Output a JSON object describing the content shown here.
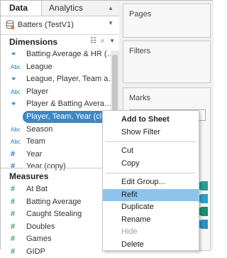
{
  "tabs": {
    "data": "Data",
    "analytics": "Analytics"
  },
  "datasource": {
    "name": "Batters (TestV1)",
    "icon": "datasource-icon"
  },
  "dimensions": {
    "title": "Dimensions",
    "items": [
      {
        "type": "link",
        "label": "Batting Average & HR (…"
      },
      {
        "type": "abc",
        "label": "League"
      },
      {
        "type": "link",
        "label": "League, Player, Team a…"
      },
      {
        "type": "abc",
        "label": "Player"
      },
      {
        "type": "link",
        "label": "Player & Batting Avera…"
      },
      {
        "type": "selected",
        "label": "Player, Team, Year (clu…"
      },
      {
        "type": "abc",
        "label": "Season"
      },
      {
        "type": "abc",
        "label": "Team"
      },
      {
        "type": "hash-blue",
        "label": "Year"
      },
      {
        "type": "hash-blue",
        "label": "Year (copy)"
      }
    ]
  },
  "measures": {
    "title": "Measures",
    "items": [
      {
        "type": "hash-green",
        "label": "At Bat"
      },
      {
        "type": "hash-green",
        "label": "Batting Average"
      },
      {
        "type": "hash-green",
        "label": "Caught Stealing"
      },
      {
        "type": "hash-green",
        "label": "Doubles"
      },
      {
        "type": "hash-green",
        "label": "Games"
      },
      {
        "type": "hash-green",
        "label": "GIDP"
      }
    ]
  },
  "right": {
    "pages": "Pages",
    "filters": "Filters",
    "marks": "Marks"
  },
  "context_menu": {
    "items": [
      {
        "label": "Add to Sheet",
        "style": "bold"
      },
      {
        "label": "Show Filter",
        "style": ""
      },
      {
        "label": "Cut",
        "style": ""
      },
      {
        "label": "Copy",
        "style": ""
      },
      {
        "label": "Edit Group...",
        "style": ""
      },
      {
        "label": "Refit",
        "style": "highlight"
      },
      {
        "label": "Duplicate",
        "style": ""
      },
      {
        "label": "Rename",
        "style": ""
      },
      {
        "label": "Hide",
        "style": "disabled"
      },
      {
        "label": "Delete",
        "style": ""
      }
    ]
  },
  "pill_colors": [
    "#2a9d8f",
    "#2ca0c8",
    "#1a8f6e",
    "#2f8fc2"
  ]
}
